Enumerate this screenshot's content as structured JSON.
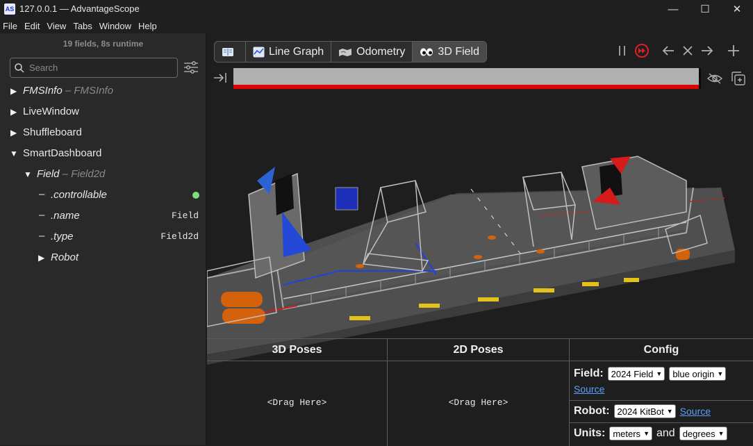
{
  "window": {
    "title": "127.0.0.1 — AdvantageScope",
    "app_icon_text": "AS",
    "controls": {
      "minimize": "—",
      "maximize": "☐",
      "close": "✕"
    }
  },
  "menu": [
    "File",
    "Edit",
    "View",
    "Tabs",
    "Window",
    "Help"
  ],
  "sidebar": {
    "summary": "19 fields, 8s runtime",
    "search_placeholder": "Search",
    "tree": [
      {
        "label": "FMSInfo",
        "sub": " – FMSInfo"
      },
      {
        "label": "LiveWindow"
      },
      {
        "label": "Shuffleboard"
      },
      {
        "label": "SmartDashboard"
      },
      {
        "label": "Field",
        "sub": " – Field2d"
      },
      {
        "label": ".controllable"
      },
      {
        "label": ".name",
        "value": "Field"
      },
      {
        "label": ".type",
        "value": "Field2d"
      },
      {
        "label": "Robot"
      }
    ],
    "status_color": "#7fdc7f"
  },
  "tabs": [
    {
      "label": ""
    },
    {
      "label": "Line Graph"
    },
    {
      "label": "Odometry"
    },
    {
      "label": "3D Field"
    }
  ],
  "colors": {
    "timeline_fill": "#b0b0b0",
    "timeline_accent": "#e00000",
    "live_accent": "#e02020"
  },
  "config_table": {
    "headers": [
      "3D Poses",
      "2D Poses",
      "Config"
    ],
    "drag_hint": "<Drag Here>",
    "field_label": "Field:",
    "field_value": "2024 Field",
    "origin_value": "blue origin",
    "source_link": "Source",
    "robot_label": "Robot:",
    "robot_value": "2024 KitBot",
    "units_label": "Units:",
    "units_length": "meters",
    "units_and": "and",
    "units_angle": "degrees"
  }
}
